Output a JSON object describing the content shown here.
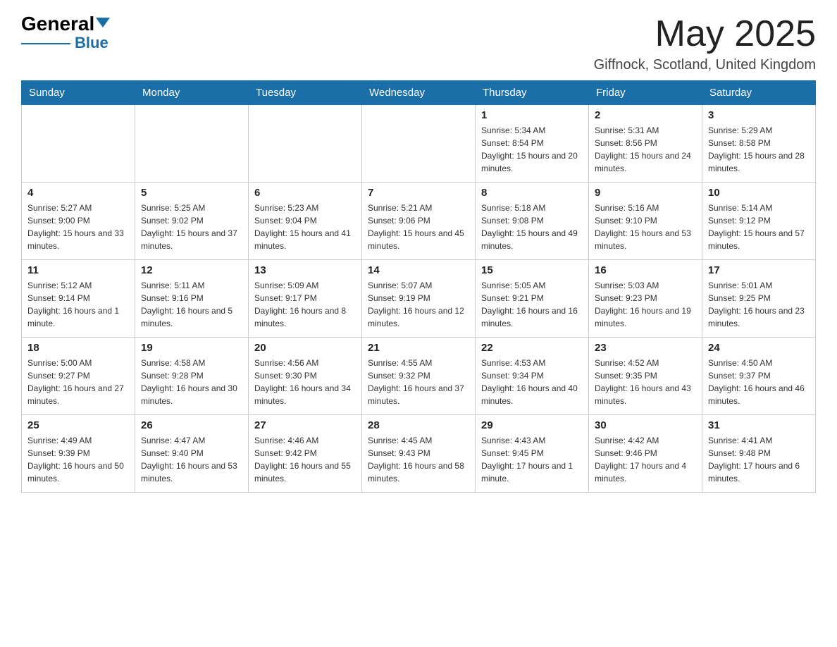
{
  "header": {
    "logo_general": "General",
    "logo_blue": "Blue",
    "month_title": "May 2025",
    "location": "Giffnock, Scotland, United Kingdom"
  },
  "columns": [
    "Sunday",
    "Monday",
    "Tuesday",
    "Wednesday",
    "Thursday",
    "Friday",
    "Saturday"
  ],
  "weeks": [
    [
      {
        "day": "",
        "info": ""
      },
      {
        "day": "",
        "info": ""
      },
      {
        "day": "",
        "info": ""
      },
      {
        "day": "",
        "info": ""
      },
      {
        "day": "1",
        "info": "Sunrise: 5:34 AM\nSunset: 8:54 PM\nDaylight: 15 hours and 20 minutes."
      },
      {
        "day": "2",
        "info": "Sunrise: 5:31 AM\nSunset: 8:56 PM\nDaylight: 15 hours and 24 minutes."
      },
      {
        "day": "3",
        "info": "Sunrise: 5:29 AM\nSunset: 8:58 PM\nDaylight: 15 hours and 28 minutes."
      }
    ],
    [
      {
        "day": "4",
        "info": "Sunrise: 5:27 AM\nSunset: 9:00 PM\nDaylight: 15 hours and 33 minutes."
      },
      {
        "day": "5",
        "info": "Sunrise: 5:25 AM\nSunset: 9:02 PM\nDaylight: 15 hours and 37 minutes."
      },
      {
        "day": "6",
        "info": "Sunrise: 5:23 AM\nSunset: 9:04 PM\nDaylight: 15 hours and 41 minutes."
      },
      {
        "day": "7",
        "info": "Sunrise: 5:21 AM\nSunset: 9:06 PM\nDaylight: 15 hours and 45 minutes."
      },
      {
        "day": "8",
        "info": "Sunrise: 5:18 AM\nSunset: 9:08 PM\nDaylight: 15 hours and 49 minutes."
      },
      {
        "day": "9",
        "info": "Sunrise: 5:16 AM\nSunset: 9:10 PM\nDaylight: 15 hours and 53 minutes."
      },
      {
        "day": "10",
        "info": "Sunrise: 5:14 AM\nSunset: 9:12 PM\nDaylight: 15 hours and 57 minutes."
      }
    ],
    [
      {
        "day": "11",
        "info": "Sunrise: 5:12 AM\nSunset: 9:14 PM\nDaylight: 16 hours and 1 minute."
      },
      {
        "day": "12",
        "info": "Sunrise: 5:11 AM\nSunset: 9:16 PM\nDaylight: 16 hours and 5 minutes."
      },
      {
        "day": "13",
        "info": "Sunrise: 5:09 AM\nSunset: 9:17 PM\nDaylight: 16 hours and 8 minutes."
      },
      {
        "day": "14",
        "info": "Sunrise: 5:07 AM\nSunset: 9:19 PM\nDaylight: 16 hours and 12 minutes."
      },
      {
        "day": "15",
        "info": "Sunrise: 5:05 AM\nSunset: 9:21 PM\nDaylight: 16 hours and 16 minutes."
      },
      {
        "day": "16",
        "info": "Sunrise: 5:03 AM\nSunset: 9:23 PM\nDaylight: 16 hours and 19 minutes."
      },
      {
        "day": "17",
        "info": "Sunrise: 5:01 AM\nSunset: 9:25 PM\nDaylight: 16 hours and 23 minutes."
      }
    ],
    [
      {
        "day": "18",
        "info": "Sunrise: 5:00 AM\nSunset: 9:27 PM\nDaylight: 16 hours and 27 minutes."
      },
      {
        "day": "19",
        "info": "Sunrise: 4:58 AM\nSunset: 9:28 PM\nDaylight: 16 hours and 30 minutes."
      },
      {
        "day": "20",
        "info": "Sunrise: 4:56 AM\nSunset: 9:30 PM\nDaylight: 16 hours and 34 minutes."
      },
      {
        "day": "21",
        "info": "Sunrise: 4:55 AM\nSunset: 9:32 PM\nDaylight: 16 hours and 37 minutes."
      },
      {
        "day": "22",
        "info": "Sunrise: 4:53 AM\nSunset: 9:34 PM\nDaylight: 16 hours and 40 minutes."
      },
      {
        "day": "23",
        "info": "Sunrise: 4:52 AM\nSunset: 9:35 PM\nDaylight: 16 hours and 43 minutes."
      },
      {
        "day": "24",
        "info": "Sunrise: 4:50 AM\nSunset: 9:37 PM\nDaylight: 16 hours and 46 minutes."
      }
    ],
    [
      {
        "day": "25",
        "info": "Sunrise: 4:49 AM\nSunset: 9:39 PM\nDaylight: 16 hours and 50 minutes."
      },
      {
        "day": "26",
        "info": "Sunrise: 4:47 AM\nSunset: 9:40 PM\nDaylight: 16 hours and 53 minutes."
      },
      {
        "day": "27",
        "info": "Sunrise: 4:46 AM\nSunset: 9:42 PM\nDaylight: 16 hours and 55 minutes."
      },
      {
        "day": "28",
        "info": "Sunrise: 4:45 AM\nSunset: 9:43 PM\nDaylight: 16 hours and 58 minutes."
      },
      {
        "day": "29",
        "info": "Sunrise: 4:43 AM\nSunset: 9:45 PM\nDaylight: 17 hours and 1 minute."
      },
      {
        "day": "30",
        "info": "Sunrise: 4:42 AM\nSunset: 9:46 PM\nDaylight: 17 hours and 4 minutes."
      },
      {
        "day": "31",
        "info": "Sunrise: 4:41 AM\nSunset: 9:48 PM\nDaylight: 17 hours and 6 minutes."
      }
    ]
  ]
}
